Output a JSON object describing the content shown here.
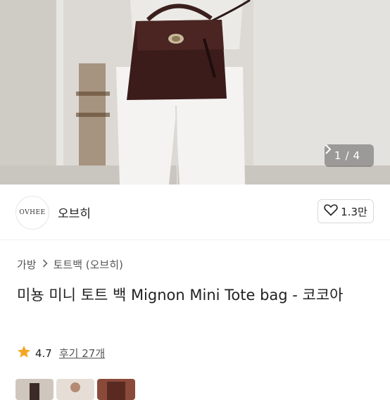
{
  "gallery": {
    "current": "1",
    "separator": "/",
    "total": "4",
    "next_icon": "chevron-right-icon"
  },
  "seller": {
    "logo_text": "OVHEE",
    "name": "오브히",
    "like_count": "1.3만",
    "like_icon": "heart-outline-icon"
  },
  "breadcrumb": {
    "category": "가방",
    "separator_icon": "chevron-right-icon",
    "subcategory": "토트백 (오브히)"
  },
  "product": {
    "title": "미뇽 미니 토트 백 Mignon Mini Tote bag - 코코아"
  },
  "rating": {
    "star_icon": "star-icon",
    "score": "4.7",
    "reviews": "후기 27개",
    "star_color": "#f5a623"
  }
}
